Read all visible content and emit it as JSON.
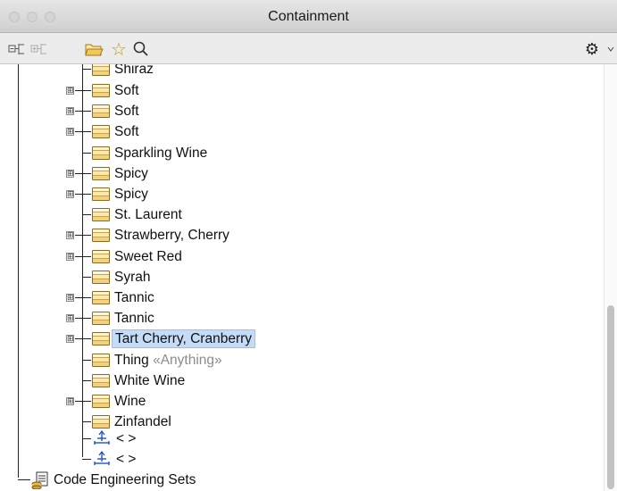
{
  "window": {
    "title": "Containment"
  },
  "toolbar": {
    "icons": [
      "collapse-all-icon",
      "expand-all-icon",
      "open-folder-icon",
      "favorite-star-icon",
      "search-icon",
      "gear-icon",
      "dropdown-arrow-icon"
    ],
    "collapse_glyph": "⊟",
    "expand_glyph": "⊞",
    "star_glyph": "☆",
    "gear_glyph": "⚙"
  },
  "tree": {
    "partial_top_label": "Shiraz",
    "items": [
      {
        "label": "Soft",
        "expandable": true
      },
      {
        "label": "Soft",
        "expandable": true
      },
      {
        "label": "Soft",
        "expandable": true
      },
      {
        "label": "Sparkling Wine",
        "expandable": false
      },
      {
        "label": "Spicy",
        "expandable": true
      },
      {
        "label": "Spicy",
        "expandable": true
      },
      {
        "label": "St. Laurent",
        "expandable": false
      },
      {
        "label": "Strawberry, Cherry",
        "expandable": true
      },
      {
        "label": "Sweet Red",
        "expandable": true
      },
      {
        "label": "Syrah",
        "expandable": false
      },
      {
        "label": "Tannic",
        "expandable": true
      },
      {
        "label": "Tannic",
        "expandable": true
      },
      {
        "label": "Tart Cherry, Cranberry",
        "expandable": true,
        "selected": true
      },
      {
        "label": "Thing",
        "stereotype": "«Anything»",
        "expandable": false
      },
      {
        "label": "White Wine",
        "expandable": false
      },
      {
        "label": "Wine",
        "expandable": true
      },
      {
        "label": "Zinfandel",
        "expandable": false
      }
    ],
    "associations": [
      {
        "label": "< >"
      },
      {
        "label": "< >"
      }
    ],
    "root_sibling": {
      "label": "Code Engineering Sets"
    }
  },
  "colors": {
    "selection": "#c4dcf7",
    "stereotype": "#8c8c8c"
  }
}
